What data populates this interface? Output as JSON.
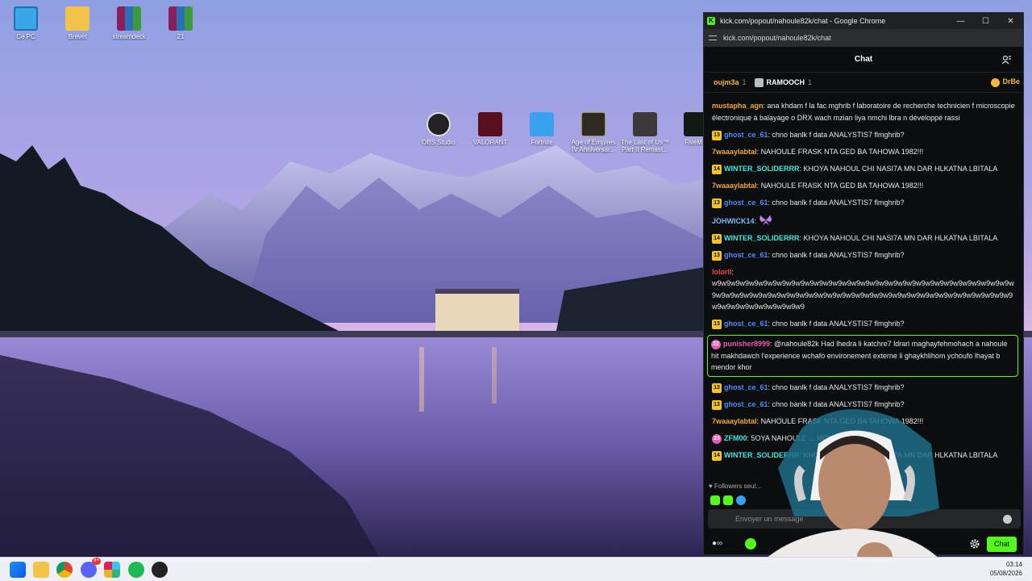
{
  "desktop": {
    "icons": [
      {
        "label": "Ce PC",
        "icon": "monitor-icon"
      },
      {
        "label": "Brevet",
        "icon": "folder-icon"
      },
      {
        "label": "streamdeck",
        "icon": "winrar-archive-icon"
      },
      {
        "label": "21",
        "icon": "winrar-archive-icon"
      }
    ],
    "apps": [
      {
        "label": "OBS Studio",
        "icon": "obs-icon"
      },
      {
        "label": "VALORANT",
        "icon": "valorant-icon"
      },
      {
        "label": "Fortnite",
        "icon": "fortnite-icon"
      },
      {
        "label": "Age of Empires IV Anniversar...",
        "icon": "aoe4-icon"
      },
      {
        "label": "The Last of Us™ Part II Remast...",
        "icon": "tlou-icon"
      },
      {
        "label": "FiveM",
        "icon": "fivem-icon"
      }
    ]
  },
  "browser": {
    "title": "kick.com/popout/nahoule82k/chat - Google Chrome",
    "url": "kick.com/popout/nahoule82k/chat",
    "controls": {
      "minimize": "—",
      "maximize": "☐",
      "close": "✕"
    }
  },
  "chat": {
    "header": "Chat",
    "pinned": {
      "first_user": "oujm3a",
      "first_count": "1",
      "second_user": "RAMOOCH",
      "second_count": "1",
      "third_user": "DrBe"
    },
    "messages": [
      {
        "badge": "",
        "user": "mustapha_agn",
        "color": "#f2a63b",
        "sep": ": ",
        "text": "ana khdam f la fac mghrib f laboratoire de recherche technicien f microscopie électronique à balayage o DRX wach mzian liya nmchi lbra n développé rassi"
      },
      {
        "badge": "13",
        "user": "ghost_ce_61",
        "color": "#4f8cf7",
        "sep": ": ",
        "text": "chno banlk f data ANALYSTIS7 flmghrib?"
      },
      {
        "badge": "",
        "user": "7waaaylabtal",
        "color": "#f2a63b",
        "sep": ": ",
        "text": "NAHOULE FRASK NTA GED BA TAHOWA 1982!!!"
      },
      {
        "badge": "14",
        "user": "WINTER_SOLIDERRR",
        "color": "#3ee8e0",
        "sep": ": ",
        "text": "KHOYA NAHOUL CHI NASI7A MN DAR HLKATNA LBITALA"
      },
      {
        "badge": "",
        "user": "7waaaylabtal",
        "color": "#f2a63b",
        "sep": ": ",
        "text": "NAHOULE FRASK NTA GED BA TAHOWA 1982!!!"
      },
      {
        "badge": "13",
        "user": "ghost_ce_61",
        "color": "#4f8cf7",
        "sep": ": ",
        "text": "chno banlk f data ANALYSTIS7 flmghrib?"
      },
      {
        "badge": "",
        "user": "JOHWICK14",
        "color": "#7fb8ff",
        "sep": ": ",
        "text": "",
        "emote": "butterfly-emote"
      },
      {
        "badge": "14",
        "user": "WINTER_SOLIDERRR",
        "color": "#3ee8e0",
        "sep": ": ",
        "text": "KHOYA NAHOUL CHI NASI7A MN DAR HLKATNA LBITALA"
      },
      {
        "badge": "13",
        "user": "ghost_ce_61",
        "color": "#4f8cf7",
        "sep": ": ",
        "text": "chno banlk f data ANALYSTIS7 flmghrib?"
      },
      {
        "badge": "",
        "user": "lolorll",
        "color": "#f04848",
        "sep": ":",
        "text": "w9w9w9w9w9w9w9w9w9w9w9w9w9w9w9w9w9w9w9w9w9w9w9w9w9w9w9w9w9w9w9w9w9w9w9w9w9w9w9w9w9w9w9w9w9w9w9w9w9w9w9w9w9w9w9w9w9w9w9w9w9w9w9w9w9w9w9w9w9w9w9w9w9w9w9"
      },
      {
        "badge": "13",
        "user": "ghost_ce_61",
        "color": "#4f8cf7",
        "sep": ": ",
        "text": "chno banlk f data ANALYSTIS7 flmghrib?"
      },
      {
        "badge": "22",
        "badge_style": "pink",
        "user": "punisher8999",
        "color": "#e95ab2",
        "sep": ": ",
        "text": "@nahoule82k Had lhedra li katchre7 ldrari maghayfehmohach a nahoule hit makhdawch l'experience wchafo environement externe li ghaykhlihom ychoufo lhayat b mendor khor",
        "highlight": true
      },
      {
        "badge": "13",
        "user": "ghost_ce_61",
        "color": "#4f8cf7",
        "sep": ": ",
        "text": "chno banlk f data ANALYSTIS7 flmghrib?"
      },
      {
        "badge": "13",
        "user": "ghost_ce_61",
        "color": "#4f8cf7",
        "sep": ": ",
        "text": "chno banlk f data ANALYSTIS7 flmghrib?"
      },
      {
        "badge": "",
        "user": "7waaaylabtal",
        "color": "#f2a63b",
        "sep": ": ",
        "text": "NAHOULE FRASK NTA GED BA TAHOWA 1982!!!"
      },
      {
        "badge": "23",
        "badge_style": "pink",
        "user": "ZFM00",
        "color": "#3ee8e0",
        "sep": ": ",
        "text": "5OYA NAHOULE ... MOUHAMED"
      },
      {
        "badge": "14",
        "user": "WINTER_SOLIDERRR",
        "color": "#3ee8e0",
        "sep": ": ",
        "text": "KHOYA NAHOUL CHI NASI7A MN DAR HLKATNA LBITALA"
      }
    ],
    "followers_label": "Followers seul...",
    "input_placeholder": "Envoyer un message",
    "send_label": "Chat"
  },
  "taskbar": {
    "time": "03:14",
    "date": "05/08/2026",
    "discord_badge": "9+"
  }
}
